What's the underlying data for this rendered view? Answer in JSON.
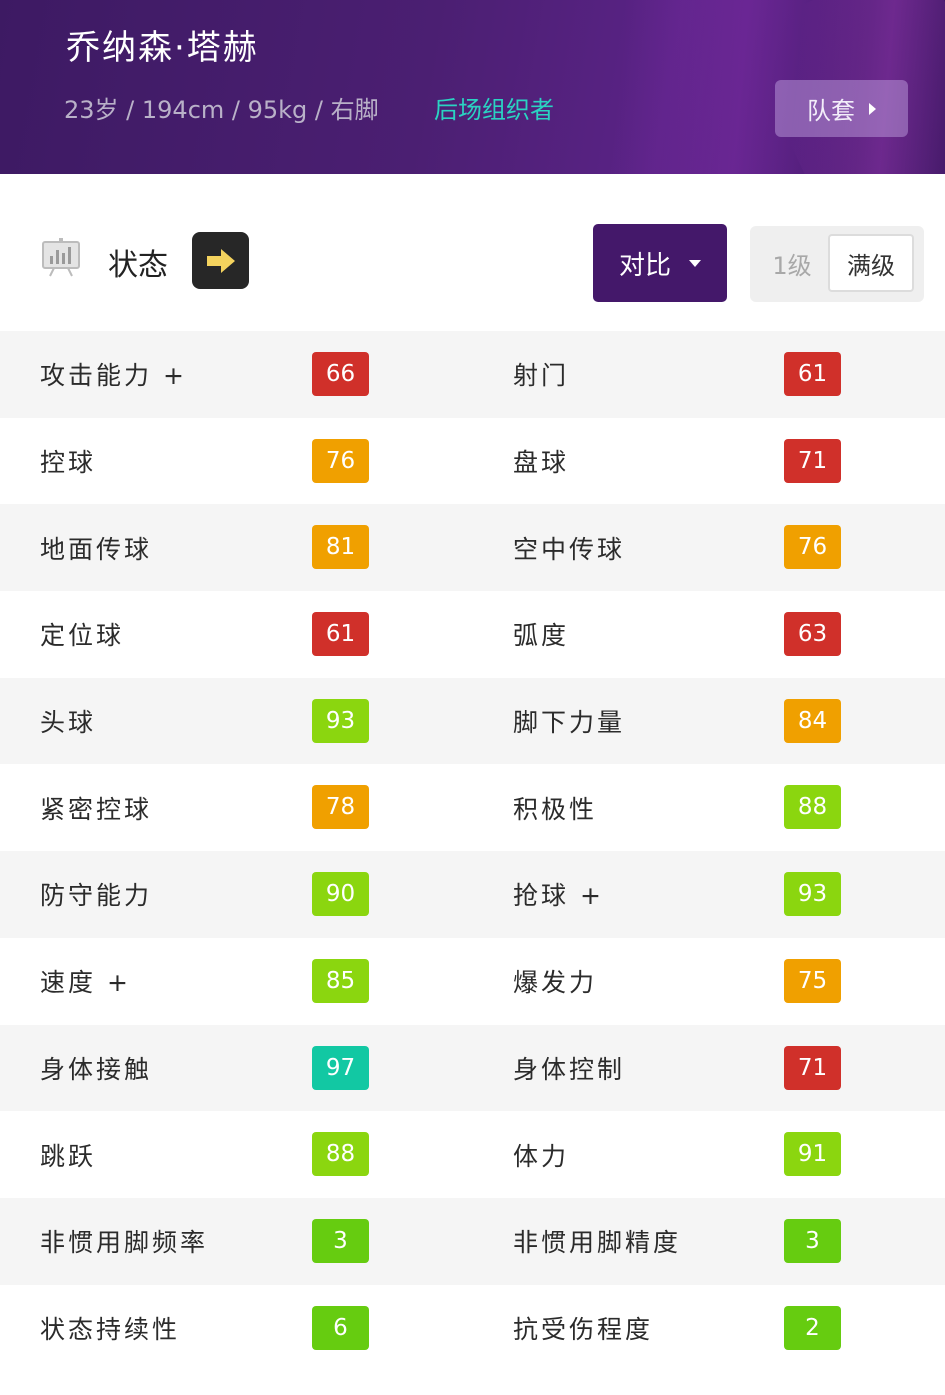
{
  "header": {
    "player_name": "乔纳森·塔赫",
    "meta": "23岁 / 194cm / 95kg / 右脚",
    "role": "后场组织者",
    "kit_button_label": "队套"
  },
  "toolbar": {
    "status_label": "状态",
    "compare_label": "对比",
    "level_options": [
      "1级",
      "满级"
    ],
    "level_selected": "满级"
  },
  "colors": {
    "header_purple": "#44186a",
    "role_teal": "#2ad3c2",
    "badge_red": "#d0302a",
    "badge_orange": "#f0a000",
    "badge_lime": "#8bd60f",
    "badge_green": "#66cc10",
    "badge_teal": "#12c8a3"
  },
  "icons": {
    "chart": "chart-board-icon",
    "arrow": "arrow-right-icon",
    "kit_caret": "caret-right-icon",
    "compare_caret": "caret-down-icon"
  },
  "stats": [
    {
      "left": {
        "name": "攻击能力 +",
        "value": "66",
        "color": "#d0302a"
      },
      "right": {
        "name": "射门",
        "value": "61",
        "color": "#d0302a"
      }
    },
    {
      "left": {
        "name": "控球",
        "value": "76",
        "color": "#f0a000"
      },
      "right": {
        "name": "盘球",
        "value": "71",
        "color": "#d0302a"
      }
    },
    {
      "left": {
        "name": "地面传球",
        "value": "81",
        "color": "#f0a000"
      },
      "right": {
        "name": "空中传球",
        "value": "76",
        "color": "#f0a000"
      }
    },
    {
      "left": {
        "name": "定位球",
        "value": "61",
        "color": "#d0302a"
      },
      "right": {
        "name": "弧度",
        "value": "63",
        "color": "#d0302a"
      }
    },
    {
      "left": {
        "name": "头球",
        "value": "93",
        "color": "#8bd60f"
      },
      "right": {
        "name": "脚下力量",
        "value": "84",
        "color": "#f0a000"
      }
    },
    {
      "left": {
        "name": "紧密控球",
        "value": "78",
        "color": "#f0a000"
      },
      "right": {
        "name": "积极性",
        "value": "88",
        "color": "#8bd60f"
      }
    },
    {
      "left": {
        "name": "防守能力",
        "value": "90",
        "color": "#8bd60f"
      },
      "right": {
        "name": "抢球 +",
        "value": "93",
        "color": "#8bd60f"
      }
    },
    {
      "left": {
        "name": "速度 +",
        "value": "85",
        "color": "#8bd60f"
      },
      "right": {
        "name": "爆发力",
        "value": "75",
        "color": "#f0a000"
      }
    },
    {
      "left": {
        "name": "身体接触",
        "value": "97",
        "color": "#12c8a3"
      },
      "right": {
        "name": "身体控制",
        "value": "71",
        "color": "#d0302a"
      }
    },
    {
      "left": {
        "name": "跳跃",
        "value": "88",
        "color": "#8bd60f"
      },
      "right": {
        "name": "体力",
        "value": "91",
        "color": "#8bd60f"
      }
    },
    {
      "left": {
        "name": "非惯用脚频率",
        "value": "3",
        "color": "#66cc10"
      },
      "right": {
        "name": "非惯用脚精度",
        "value": "3",
        "color": "#66cc10"
      }
    },
    {
      "left": {
        "name": "状态持续性",
        "value": "6",
        "color": "#66cc10"
      },
      "right": {
        "name": "抗受伤程度",
        "value": "2",
        "color": "#66cc10"
      }
    }
  ]
}
